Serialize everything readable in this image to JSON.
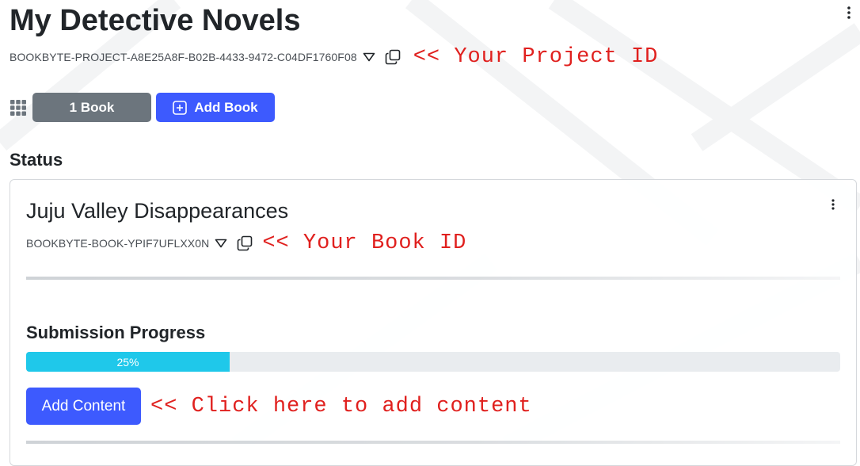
{
  "project": {
    "title": "My Detective Novels",
    "id": "BOOKBYTE-PROJECT-A8E25A8F-B02B-4433-9472-C04DF1760F08",
    "id_note": "<< Your Project ID"
  },
  "toolbar": {
    "book_count_label": "1 Book",
    "add_book_label": "Add Book"
  },
  "status": {
    "heading": "Status"
  },
  "book": {
    "title": "Juju Valley Disappearances",
    "id": "BOOKBYTE-BOOK-YPIF7UFLXX0N",
    "id_note": "<< Your Book ID",
    "submission_heading": "Submission Progress",
    "progress_percent": 25,
    "progress_label": "25%",
    "add_content_label": "Add Content",
    "add_content_note": "<< Click here to add content"
  },
  "colors": {
    "primary": "#3d5afe",
    "secondary": "#6c757d",
    "progress": "#1fc8ea",
    "annotation": "#e0201e"
  },
  "icons": {
    "menu": "kebab-icon",
    "dropdown": "caret-down-icon",
    "copy": "copy-icon",
    "grid": "grid-icon",
    "add": "plus-square-icon"
  }
}
